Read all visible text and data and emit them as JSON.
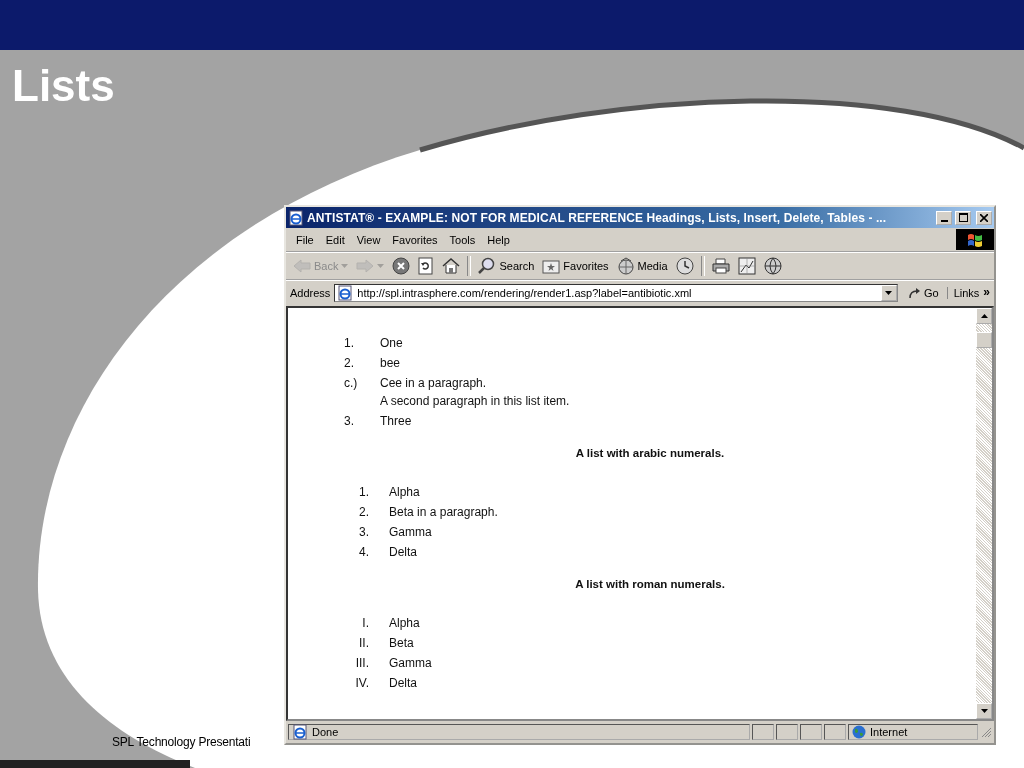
{
  "slide": {
    "title": "Lists",
    "footer": "SPL Technology Presentati"
  },
  "browser": {
    "title": "ANTISTAT® - EXAMPLE: NOT FOR MEDICAL REFERENCE Headings, Lists, Insert, Delete, Tables - ...",
    "menu": [
      "File",
      "Edit",
      "View",
      "Favorites",
      "Tools",
      "Help"
    ],
    "toolbar": [
      {
        "kind": "back",
        "label": "Back",
        "disabled": true
      },
      {
        "kind": "forward",
        "disabled": true
      },
      {
        "kind": "stop",
        "disabled": false
      },
      {
        "kind": "refresh",
        "disabled": false
      },
      {
        "kind": "home",
        "disabled": false
      },
      {
        "kind": "search",
        "label": "Search",
        "disabled": false
      },
      {
        "kind": "favorites",
        "label": "Favorites",
        "disabled": false
      },
      {
        "kind": "media",
        "label": "Media",
        "disabled": false
      },
      {
        "kind": "history",
        "disabled": false
      },
      {
        "kind": "print",
        "disabled": false
      },
      {
        "kind": "edit",
        "disabled": false
      },
      {
        "kind": "messenger",
        "disabled": false
      }
    ],
    "address": {
      "label": "Address",
      "value": "http://spl.intrasphere.com/rendering/render1.asp?label=antibiotic.xml",
      "go": "Go",
      "links": "Links",
      "links_more": "»"
    },
    "sections": [
      {
        "kind": "custom",
        "items": [
          {
            "marker": "1.",
            "lines": [
              "One"
            ]
          },
          {
            "marker": "2.",
            "lines": [
              "bee"
            ]
          },
          {
            "marker": "c.)",
            "lines": [
              "Cee in a paragraph.",
              "A second paragraph in this list item."
            ]
          },
          {
            "marker": "3.",
            "lines": [
              "Three"
            ]
          }
        ]
      },
      {
        "kind": "numbered",
        "heading": "A list with arabic numerals.",
        "items": [
          {
            "marker": "1.",
            "lines": [
              "Alpha"
            ]
          },
          {
            "marker": "2.",
            "lines": [
              "Beta in a paragraph."
            ]
          },
          {
            "marker": "3.",
            "lines": [
              "Gamma"
            ]
          },
          {
            "marker": "4.",
            "lines": [
              "Delta"
            ]
          }
        ]
      },
      {
        "kind": "numbered",
        "heading": "A list with roman numerals.",
        "items": [
          {
            "marker": "I.",
            "lines": [
              "Alpha"
            ]
          },
          {
            "marker": "II.",
            "lines": [
              "Beta"
            ]
          },
          {
            "marker": "III.",
            "lines": [
              "Gamma"
            ]
          },
          {
            "marker": "IV.",
            "lines": [
              "Delta"
            ]
          }
        ]
      }
    ],
    "status": {
      "text": "Done",
      "zone": "Internet"
    }
  }
}
